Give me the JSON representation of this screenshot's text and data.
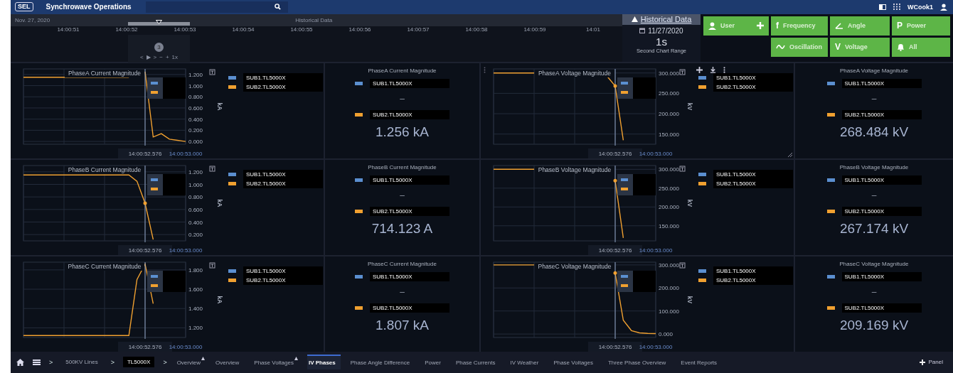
{
  "app": {
    "logo": "SEL",
    "title": "Synchrowave Operations",
    "user": "WCook1"
  },
  "timeline": {
    "date": "Nov. 27, 2020",
    "label": "Historical Data",
    "ticks": [
      "14:00:51",
      "14:00:52",
      "14:00:53",
      "14:00:54",
      "14:00:55",
      "14:00:56",
      "14:00:57",
      "14:00:58",
      "14:00:59",
      "14:01"
    ],
    "badge": "3",
    "controls": [
      "<",
      "▶",
      ">",
      "−",
      "+"
    ],
    "speed": "1x"
  },
  "historical": {
    "link": "Historical Data",
    "date": "11/27/2020",
    "range": "1s",
    "range_label": "Second Chart Range"
  },
  "filters": [
    {
      "label": "User",
      "kind": "user",
      "add": true
    },
    {
      "label": "Frequency",
      "kind": "letter",
      "glyph": "f",
      "add": false
    },
    {
      "label": "Angle",
      "kind": "angle",
      "add": false
    },
    {
      "label": "Power",
      "kind": "letter",
      "glyph": "P",
      "add": false
    },
    {
      "label": "Oscillation",
      "kind": "wave",
      "add": false
    },
    {
      "label": "Voltage",
      "kind": "letter",
      "glyph": "V",
      "add": false
    },
    {
      "label": "All",
      "kind": "bell",
      "add": false
    }
  ],
  "panels": [
    {
      "kind": "chart",
      "marker": false,
      "toolbar": false,
      "legend": [
        {
          "label": "SUB1.TL5000X",
          "color": "#5b8fd0"
        },
        {
          "label": "SUB2.TL5000X",
          "color": "#f0a030"
        }
      ],
      "chart_data": {
        "type": "line",
        "title": "PhaseA Current Magnitude",
        "ylabel": "kA",
        "categories": [
          null,
          null,
          null,
          null,
          null,
          null,
          null,
          null,
          null,
          null,
          null,
          null,
          null,
          null,
          null,
          "14:00:52.576",
          null,
          null,
          null,
          null,
          "14:00:53.000"
        ],
        "grid": true,
        "series": [
          {
            "color": "#f0a030",
            "values": [
              1.15,
              1.15,
              1.15,
              1.15,
              1.15,
              1.15,
              1.15,
              1.15,
              1.15,
              1.15,
              1.15,
              1.15,
              1.15,
              1.15,
              null,
              1.25,
              0.08,
              0.14,
              0.04,
              0.02,
              0.0
            ]
          }
        ],
        "ylim": [
          -0.05,
          1.3
        ],
        "yticks": [
          {
            "value": 0,
            "label": "0.000"
          },
          {
            "value": 0.2,
            "label": "0.200"
          },
          {
            "value": 0.4,
            "label": "0.400"
          },
          {
            "value": 0.6,
            "label": "0.600"
          },
          {
            "value": 0.8,
            "label": "0.800"
          },
          {
            "value": 1.0,
            "label": "1.000"
          },
          {
            "value": 1.2,
            "label": "1.200"
          }
        ]
      }
    },
    {
      "kind": "readout",
      "title": "PhaseA Current Magnitude",
      "legend": [
        {
          "label": "SUB1.TL5000X",
          "color": "#5b8fd0"
        },
        {
          "label": "SUB2.TL5000X",
          "color": "#f0a030"
        }
      ],
      "separator": "–",
      "value": "1.256 kA"
    },
    {
      "kind": "chart",
      "marker": true,
      "toolbar": true,
      "legend": [
        {
          "label": "SUB1.TL5000X",
          "color": "#5b8fd0"
        },
        {
          "label": "SUB2.TL5000X",
          "color": "#f0a030"
        }
      ],
      "chart_data": {
        "type": "line",
        "title": "PhaseA Voltage Magnitude",
        "ylabel": "kV",
        "categories": [
          null,
          null,
          null,
          null,
          null,
          null,
          null,
          null,
          null,
          null,
          null,
          null,
          null,
          null,
          null,
          "14:00:52.576",
          null,
          null,
          null,
          null,
          "14:00:53.000"
        ],
        "grid": true,
        "series": [
          {
            "color": "#f0a030",
            "values": [
              300,
              300,
              300,
              300,
              300,
              300,
              null,
              null,
              null,
              null,
              null,
              null,
              null,
              null,
              292,
              268,
              135,
              null,
              null,
              null,
              null
            ]
          }
        ],
        "ylim": [
          125,
          310
        ],
        "yticks": [
          {
            "value": 150,
            "label": "150.000"
          },
          {
            "value": 200,
            "label": "200.000"
          },
          {
            "value": 250,
            "label": "250.000"
          },
          {
            "value": 300,
            "label": "300.000"
          }
        ]
      }
    },
    {
      "kind": "readout",
      "title": "PhaseA Voltage Magnitude",
      "legend": [
        {
          "label": "SUB1.TL5000X",
          "color": "#5b8fd0"
        },
        {
          "label": "SUB2.TL5000X",
          "color": "#f0a030"
        }
      ],
      "separator": "–",
      "value": "268.484 kV"
    },
    {
      "kind": "chart",
      "marker": true,
      "toolbar": false,
      "legend": [
        {
          "label": "SUB1.TL5000X",
          "color": "#5b8fd0"
        },
        {
          "label": "SUB2.TL5000X",
          "color": "#f0a030"
        }
      ],
      "chart_data": {
        "type": "line",
        "title": "PhaseB Current Magnitude",
        "ylabel": "kA",
        "categories": [
          null,
          null,
          null,
          null,
          null,
          null,
          null,
          null,
          null,
          null,
          null,
          null,
          null,
          null,
          null,
          "14:00:52.576",
          null,
          null,
          null,
          null,
          "14:00:53.000"
        ],
        "grid": true,
        "series": [
          {
            "color": "#f0a030",
            "values": [
              1.15,
              1.15,
              1.15,
              1.15,
              1.15,
              1.15,
              1.15,
              1.15,
              1.15,
              1.15,
              1.15,
              1.15,
              1.15,
              1.15,
              1.05,
              0.7,
              0.12,
              null,
              null,
              null,
              null
            ]
          }
        ],
        "ylim": [
          0.1,
          1.3
        ],
        "yticks": [
          {
            "value": 0.2,
            "label": "0.200"
          },
          {
            "value": 0.4,
            "label": "0.400"
          },
          {
            "value": 0.6,
            "label": "0.600"
          },
          {
            "value": 0.8,
            "label": "0.800"
          },
          {
            "value": 1.0,
            "label": "1.000"
          },
          {
            "value": 1.2,
            "label": "1.200"
          }
        ]
      }
    },
    {
      "kind": "readout",
      "title": "PhaseB Current Magnitude",
      "legend": [
        {
          "label": "SUB1.TL5000X",
          "color": "#5b8fd0"
        },
        {
          "label": "SUB2.TL5000X",
          "color": "#f0a030"
        }
      ],
      "separator": "–",
      "value": "714.123 A"
    },
    {
      "kind": "chart",
      "marker": true,
      "toolbar": false,
      "legend": [
        {
          "label": "SUB1.TL5000X",
          "color": "#5b8fd0"
        },
        {
          "label": "SUB2.TL5000X",
          "color": "#f0a030"
        }
      ],
      "chart_data": {
        "type": "line",
        "title": "PhaseB Voltage Magnitude",
        "ylabel": "kV",
        "categories": [
          null,
          null,
          null,
          null,
          null,
          null,
          null,
          null,
          null,
          null,
          null,
          null,
          null,
          null,
          null,
          "14:00:52.576",
          null,
          null,
          null,
          null,
          "14:00:53.000"
        ],
        "grid": true,
        "series": [
          {
            "color": "#f0a030",
            "values": [
              300,
              300,
              300,
              300,
              300,
              300,
              null,
              null,
              null,
              null,
              null,
              null,
              null,
              null,
              null,
              270,
              118,
              null,
              null,
              null,
              null
            ]
          }
        ],
        "ylim": [
          110,
          310
        ],
        "yticks": [
          {
            "value": 150,
            "label": "150.000"
          },
          {
            "value": 200,
            "label": "200.000"
          },
          {
            "value": 250,
            "label": "250.000"
          },
          {
            "value": 300,
            "label": "300.000"
          }
        ]
      }
    },
    {
      "kind": "readout",
      "title": "PhaseB Voltage Magnitude",
      "legend": [
        {
          "label": "SUB1.TL5000X",
          "color": "#5b8fd0"
        },
        {
          "label": "SUB2.TL5000X",
          "color": "#f0a030"
        }
      ],
      "separator": "–",
      "value": "267.174 kV"
    },
    {
      "kind": "chart",
      "marker": false,
      "toolbar": false,
      "legend": [
        {
          "label": "SUB1.TL5000X",
          "color": "#5b8fd0"
        },
        {
          "label": "SUB2.TL5000X",
          "color": "#f0a030"
        }
      ],
      "chart_data": {
        "type": "line",
        "title": "PhaseC Current Magnitude",
        "ylabel": "kA",
        "categories": [
          null,
          null,
          null,
          null,
          null,
          null,
          null,
          null,
          null,
          null,
          null,
          null,
          null,
          null,
          null,
          "14:00:52.576",
          null,
          null,
          null,
          null,
          "14:00:53.000"
        ],
        "grid": true,
        "series": [
          {
            "color": "#f0a030",
            "values": [
              1.12,
              1.12,
              1.12,
              1.12,
              1.12,
              1.12,
              1.12,
              1.12,
              1.12,
              1.12,
              1.12,
              1.12,
              1.12,
              1.12,
              1.7,
              1.86,
              1.45,
              null,
              null,
              null,
              null
            ]
          }
        ],
        "ylim": [
          1.1,
          1.88
        ],
        "yticks": [
          {
            "value": 1.2,
            "label": "1.200"
          },
          {
            "value": 1.4,
            "label": "1.400"
          },
          {
            "value": 1.6,
            "label": "1.600"
          },
          {
            "value": 1.8,
            "label": "1.800"
          }
        ]
      }
    },
    {
      "kind": "readout",
      "title": "PhaseC Current Magnitude",
      "legend": [
        {
          "label": "SUB1.TL5000X",
          "color": "#5b8fd0"
        },
        {
          "label": "SUB2.TL5000X",
          "color": "#f0a030"
        }
      ],
      "separator": "–",
      "value": "1.807 kA"
    },
    {
      "kind": "chart",
      "marker": true,
      "toolbar": false,
      "legend": [
        {
          "label": "SUB1.TL5000X",
          "color": "#5b8fd0"
        },
        {
          "label": "SUB2.TL5000X",
          "color": "#f0a030"
        }
      ],
      "chart_data": {
        "type": "line",
        "title": "PhaseC Voltage Magnitude",
        "ylabel": "kV",
        "categories": [
          null,
          null,
          null,
          null,
          null,
          null,
          null,
          null,
          null,
          null,
          null,
          null,
          null,
          null,
          null,
          "14:00:52.576",
          null,
          null,
          null,
          null,
          "14:00:53.000"
        ],
        "grid": true,
        "series": [
          {
            "color": "#f0a030",
            "values": [
              300,
              300,
              300,
              300,
              300,
              300,
              null,
              null,
              null,
              null,
              null,
              null,
              null,
              null,
              null,
              265,
              60,
              15,
              5,
              3,
              2
            ]
          }
        ],
        "ylim": [
          -15,
          312
        ],
        "yticks": [
          {
            "value": 0,
            "label": "0.000"
          },
          {
            "value": 100,
            "label": "100.000"
          },
          {
            "value": 200,
            "label": "200.000"
          },
          {
            "value": 300,
            "label": "300.000"
          }
        ]
      }
    },
    {
      "kind": "readout",
      "title": "PhaseC Voltage Magnitude",
      "legend": [
        {
          "label": "SUB1.TL5000X",
          "color": "#5b8fd0"
        },
        {
          "label": "SUB2.TL5000X",
          "color": "#f0a030"
        }
      ],
      "separator": "–",
      "value": "209.169 kV"
    }
  ],
  "breadcrumb": [
    {
      "kind": "sep",
      "text": ">"
    },
    {
      "kind": "link",
      "text": "500KV Lines",
      "selected": false
    },
    {
      "kind": "sep",
      "text": ">"
    },
    {
      "kind": "link",
      "text": "TL5000X",
      "selected": true
    },
    {
      "kind": "sep",
      "text": ">"
    }
  ],
  "tabs": [
    {
      "label": "Overview",
      "flagged": true,
      "selected": false
    },
    {
      "label": "Overview",
      "flagged": false,
      "selected": false
    },
    {
      "label": "Phase Voltages",
      "flagged": true,
      "selected": false
    },
    {
      "label": "IV Phases",
      "flagged": false,
      "selected": true
    },
    {
      "label": "Phase Angle Difference",
      "flagged": false,
      "selected": false
    },
    {
      "label": "Power",
      "flagged": false,
      "selected": false
    },
    {
      "label": "Phase Currents",
      "flagged": false,
      "selected": false
    },
    {
      "label": "IV Weather",
      "flagged": false,
      "selected": false
    },
    {
      "label": "Phase Voltages",
      "flagged": false,
      "selected": false
    },
    {
      "label": "Three Phase Overview",
      "flagged": false,
      "selected": false
    },
    {
      "label": "Event Reports",
      "flagged": false,
      "selected": false
    }
  ],
  "panel_button": "Panel"
}
